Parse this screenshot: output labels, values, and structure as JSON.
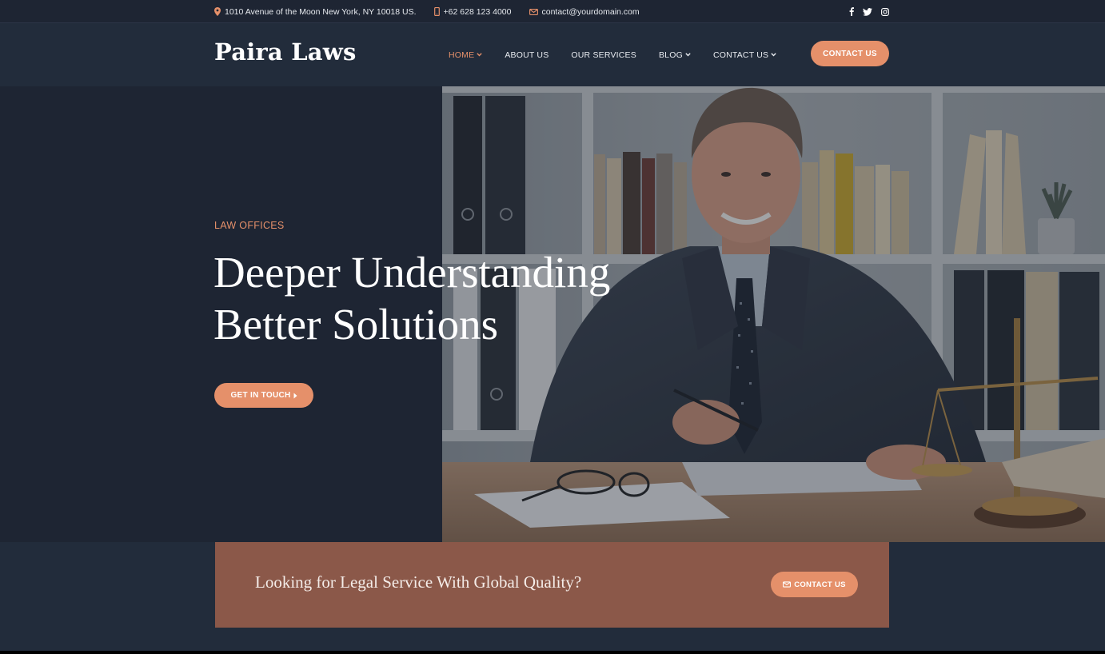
{
  "topbar": {
    "address": "1010 Avenue of the Moon New York, NY 10018 US.",
    "phone": "+62 628 123 4000",
    "email": "contact@yourdomain.com",
    "social_icons": [
      "facebook-icon",
      "twitter-icon",
      "instagram-icon"
    ]
  },
  "header": {
    "logo": "Paira Laws",
    "nav": [
      {
        "label": "HOME",
        "dropdown": true,
        "active": true
      },
      {
        "label": "ABOUT US",
        "dropdown": false
      },
      {
        "label": "OUR SERVICES",
        "dropdown": false
      },
      {
        "label": "BLOG",
        "dropdown": true
      },
      {
        "label": "CONTACT US",
        "dropdown": true
      }
    ],
    "cta_label": "CONTACT US"
  },
  "hero": {
    "eyebrow": "LAW OFFICES",
    "headline_line1": "Deeper Understanding",
    "headline_line2": "Better Solutions",
    "button_label": "GET IN TOUCH"
  },
  "cta_band": {
    "text": "Looking for Legal Service With Global Quality?",
    "button_label": "CONTACT US"
  },
  "colors": {
    "accent": "#e5906a",
    "dark_navy": "#1e2533",
    "header_bg": "#222c3b",
    "cta_band": "#8b5849"
  }
}
